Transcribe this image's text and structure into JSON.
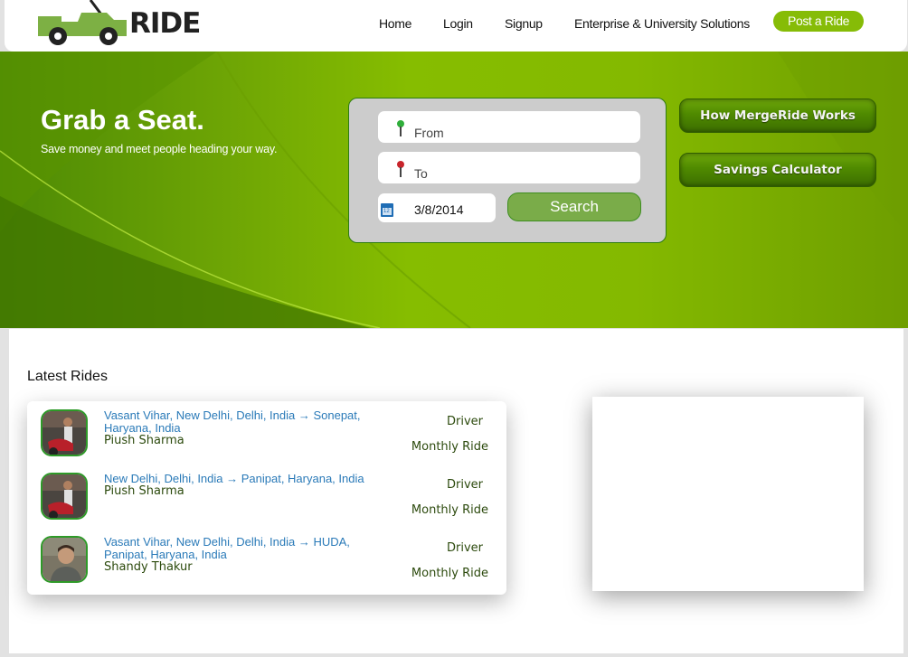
{
  "header": {
    "logo_text": "RIDE",
    "nav": [
      {
        "label": "Home"
      },
      {
        "label": "Login"
      },
      {
        "label": "Signup"
      },
      {
        "label": "Enterprise & University Solutions"
      }
    ],
    "post_ride_label": "Post a Ride"
  },
  "hero": {
    "title": "Grab a Seat.",
    "subtitle": "Save money and meet people heading your way.",
    "search": {
      "from_placeholder": "From",
      "to_placeholder": "To",
      "date_value": "3/8/2014",
      "calendar_day": "12",
      "search_label": "Search"
    },
    "side_buttons": {
      "how_it_works": "How MergeRide Works",
      "savings_calculator": "Savings Calculator"
    }
  },
  "latest_rides": {
    "title": "Latest Rides",
    "items": [
      {
        "route": "Vasant Vihar, New Delhi, Delhi, India → Sonepat, Haryana, India",
        "name": "Piush Sharma",
        "role": "Driver",
        "frequency": "Monthly Ride"
      },
      {
        "route": "New Delhi, Delhi, India → Panipat, Haryana, India",
        "name": "Piush Sharma",
        "role": "Driver",
        "frequency": "Monthly Ride"
      },
      {
        "route": "Vasant Vihar, New Delhi, Delhi, India → HUDA, Panipat, Haryana, India",
        "name": "Shandy Thakur",
        "role": "Driver",
        "frequency": "Monthly Ride"
      }
    ]
  },
  "colors": {
    "brand_green": "#86bc07",
    "link_blue": "#2a7ab8",
    "text_dark_green": "#2c4a0d"
  }
}
